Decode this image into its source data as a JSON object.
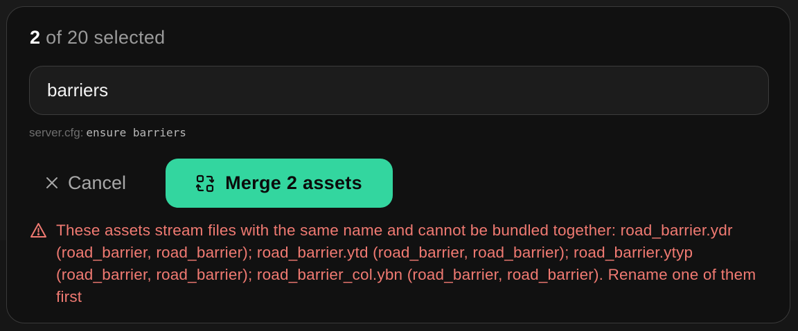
{
  "selection": {
    "count": "2",
    "suffix": " of 20 selected"
  },
  "name_input": {
    "value": "barriers",
    "placeholder": ""
  },
  "hint": {
    "label": "server.cfg:",
    "code": "ensure barriers"
  },
  "actions": {
    "cancel_icon": "close-icon",
    "cancel_label": "Cancel",
    "merge_icon": "merge-icon",
    "merge_label": "Merge 2 assets"
  },
  "error": {
    "icon": "warning-triangle-icon",
    "message": "These assets stream files with the same name and cannot be bundled together: road_barrier.ydr (road_barrier, road_barrier); road_barrier.ytd (road_barrier, road_barrier); road_barrier.ytyp (road_barrier, road_barrier); road_barrier_col.ybn (road_barrier, road_barrier). Rename one of them first"
  },
  "colors": {
    "accent": "#33d69f",
    "error": "#f07a72",
    "panel_bg": "#111111",
    "page_bg": "#1a1a1a"
  }
}
